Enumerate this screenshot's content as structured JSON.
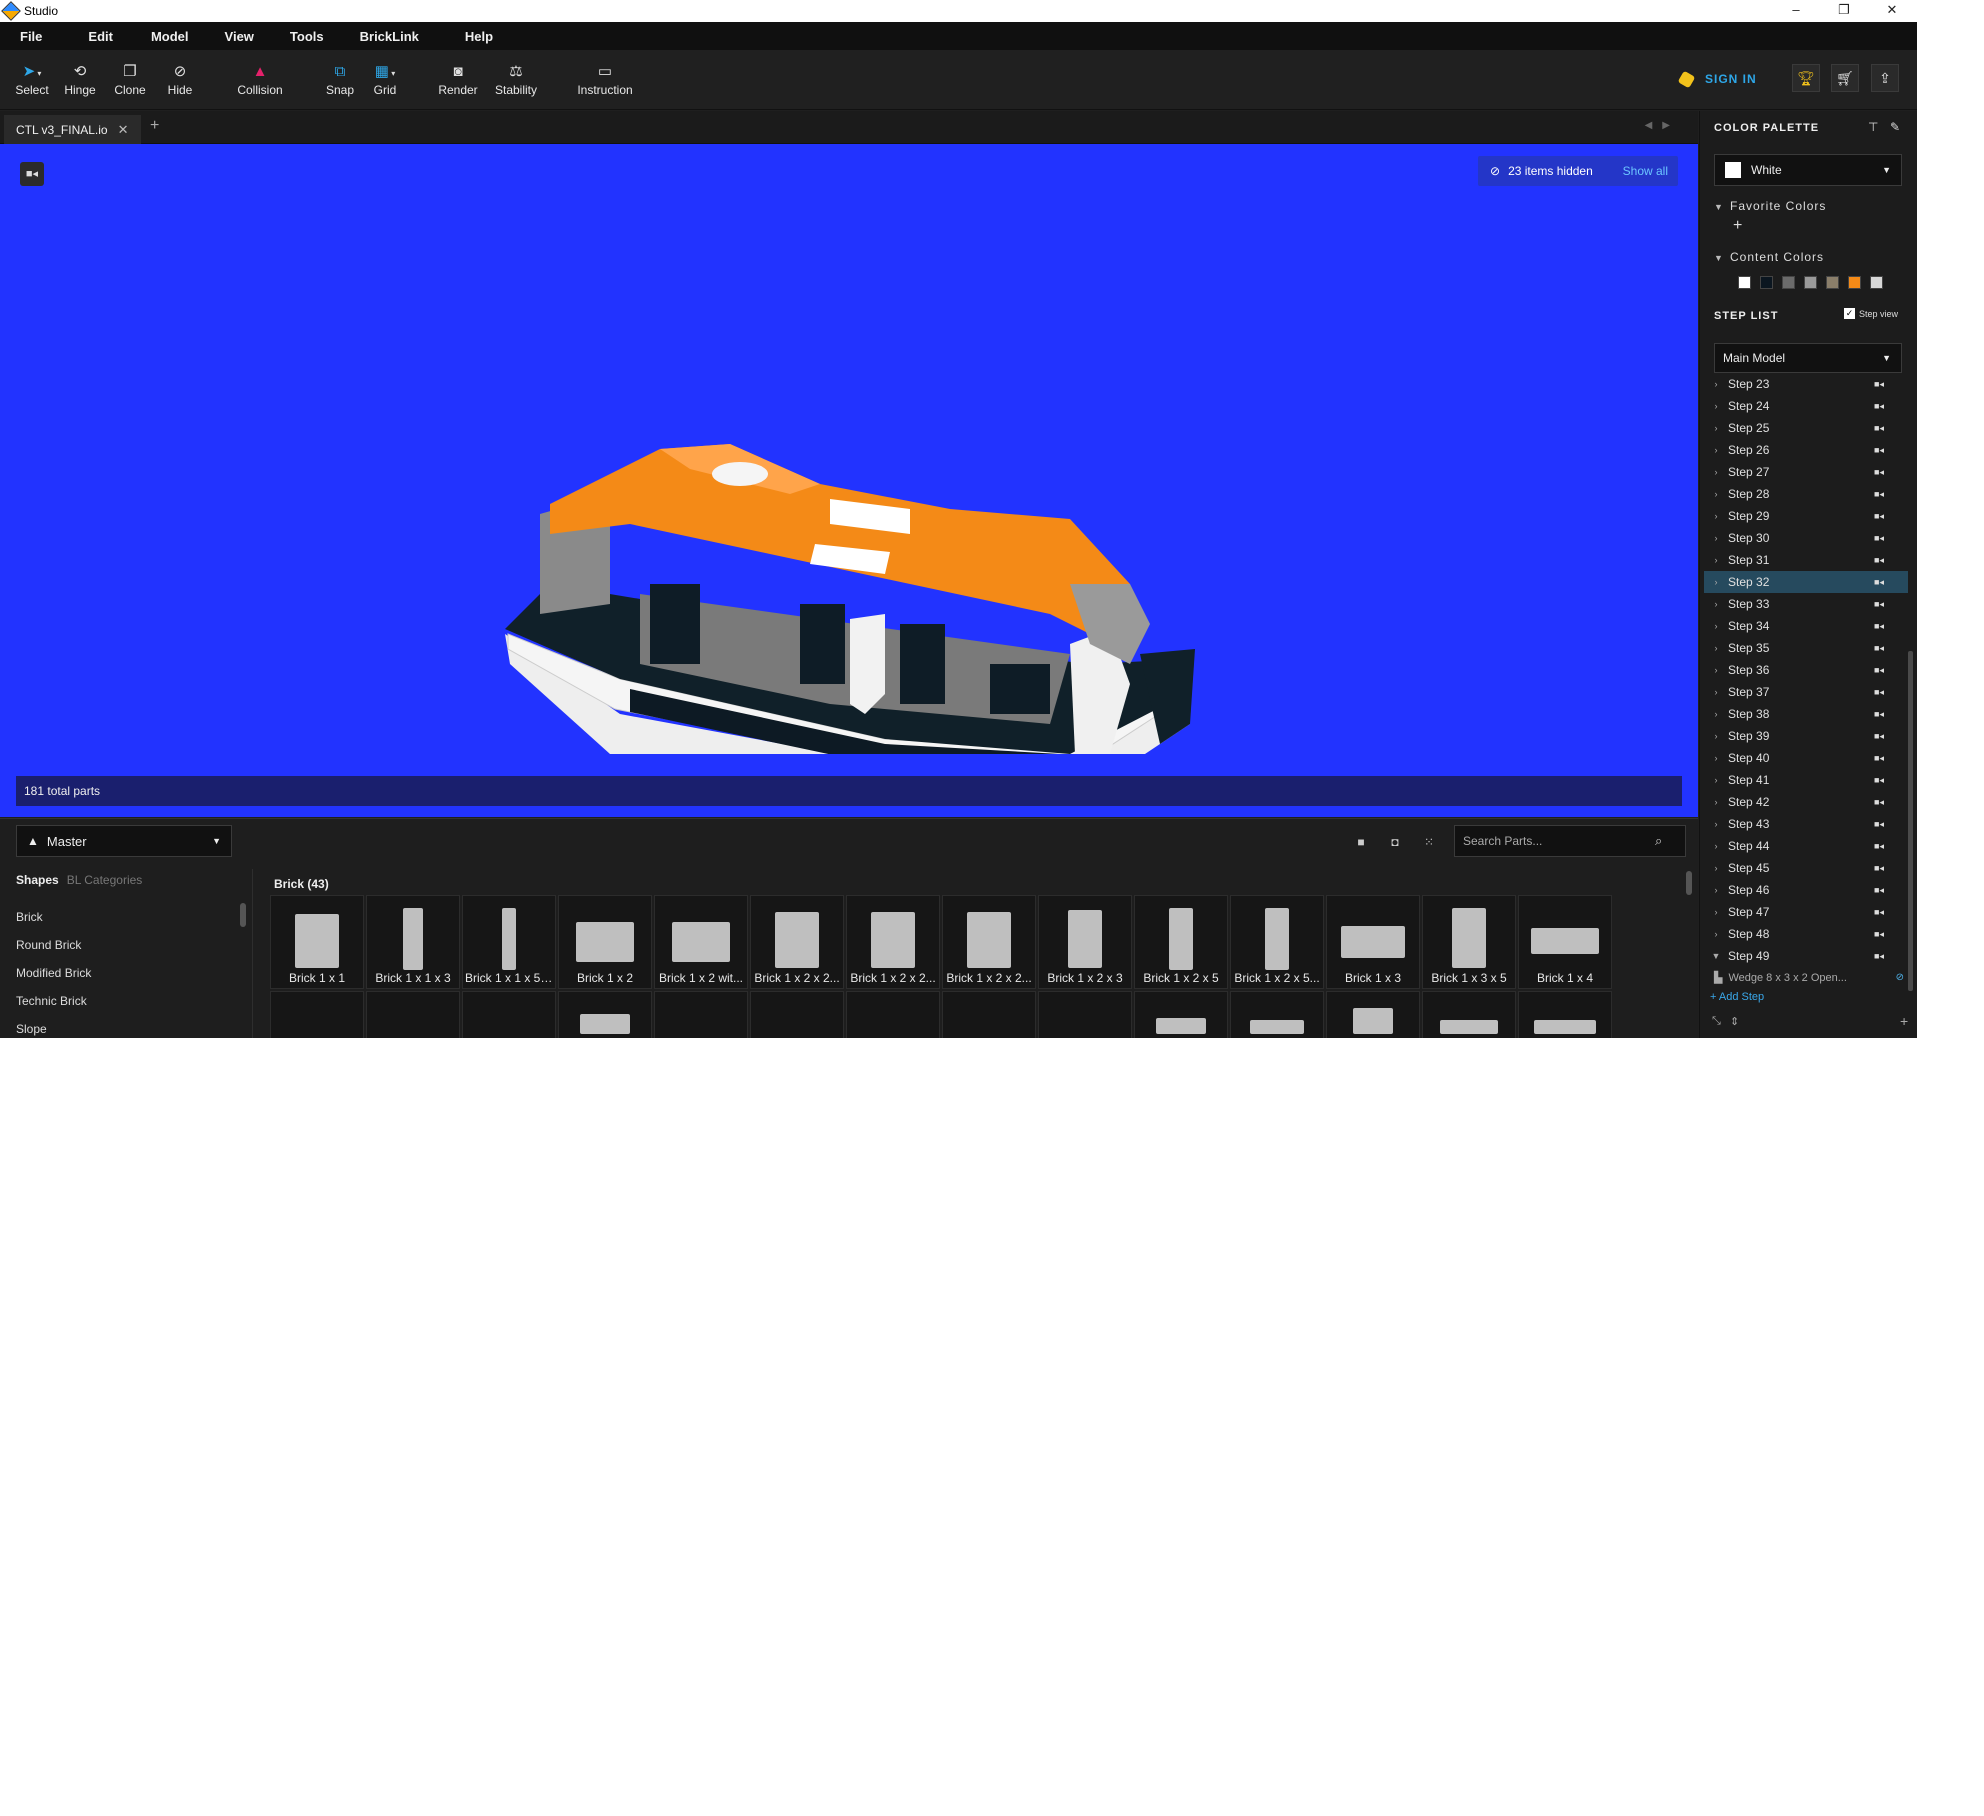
{
  "window": {
    "title": "Studio",
    "controls": [
      "–",
      "❐",
      "✕"
    ]
  },
  "menu": [
    "File",
    "Edit",
    "Model",
    "View",
    "Tools",
    "BrickLink",
    "Help"
  ],
  "toolbar": {
    "tools": [
      {
        "label": "Select",
        "icon": "pointer-icon"
      },
      {
        "label": "Hinge",
        "icon": "hinge-icon"
      },
      {
        "label": "Clone",
        "icon": "clone-icon"
      },
      {
        "label": "Hide",
        "icon": "hide-icon"
      },
      {
        "label": "Collision",
        "icon": "collision-icon"
      },
      {
        "label": "Snap",
        "icon": "snap-icon"
      },
      {
        "label": "Grid",
        "icon": "grid-icon"
      },
      {
        "label": "Render",
        "icon": "camera-icon"
      },
      {
        "label": "Stability",
        "icon": "stability-icon"
      },
      {
        "label": "Instruction",
        "icon": "instruction-icon"
      }
    ],
    "sign_in": "SIGN IN",
    "accent": "#2ea7e8"
  },
  "tab": {
    "title": "CTL v3_FINAL.io"
  },
  "viewport": {
    "background": "#2233ff",
    "hidden_text": "23 items hidden",
    "show_all": "Show all",
    "parts_total": "181 total parts"
  },
  "bottom": {
    "palette_dropdown": "Master",
    "search_placeholder": "Search Parts...",
    "category_tabs": [
      "Shapes",
      "BL Categories"
    ],
    "categories": [
      "Brick",
      "Round Brick",
      "Modified Brick",
      "Technic Brick",
      "Slope"
    ],
    "group_title": "Brick (43)",
    "parts": [
      "Brick 1 x 1",
      "Brick 1 x 1 x 3",
      "Brick 1 x 1 x 5 -...",
      "Brick 1 x 2",
      "Brick 1 x 2 wit...",
      "Brick 1 x 2 x 2...",
      "Brick 1 x 2 x 2...",
      "Brick 1 x 2 x 2...",
      "Brick 1 x 2 x 3",
      "Brick 1 x 2 x 5",
      "Brick 1 x 2 x 5...",
      "Brick 1 x 3",
      "Brick 1 x 3 x 5",
      "Brick 1 x 4"
    ]
  },
  "right_panel": {
    "color_palette_title": "COLOR PALETTE",
    "selected_color": "White",
    "favorite_colors": "Favorite Colors",
    "content_colors": "Content Colors",
    "content_swatches": [
      "#ffffff",
      "#0b1620",
      "#6b6b6b",
      "#9a9a9a",
      "#8a7e6a",
      "#f48a17",
      "#d8d8d8"
    ],
    "step_list_title": "STEP LIST",
    "step_view": "Step view",
    "model_dropdown": "Main Model",
    "steps": [
      "Step 23",
      "Step 24",
      "Step 25",
      "Step 26",
      "Step 27",
      "Step 28",
      "Step 29",
      "Step 30",
      "Step 31",
      "Step 32",
      "Step 33",
      "Step 34",
      "Step 35",
      "Step 36",
      "Step 37",
      "Step 38",
      "Step 39",
      "Step 40",
      "Step 41",
      "Step 42",
      "Step 43",
      "Step 44",
      "Step 45",
      "Step 46",
      "Step 47",
      "Step 48",
      "Step 49"
    ],
    "active_step": "Step 32",
    "expanded_step": "Step 49",
    "wedge_part": "Wedge 8 x 3 x 2 Open...",
    "add_step": "Add Step"
  }
}
